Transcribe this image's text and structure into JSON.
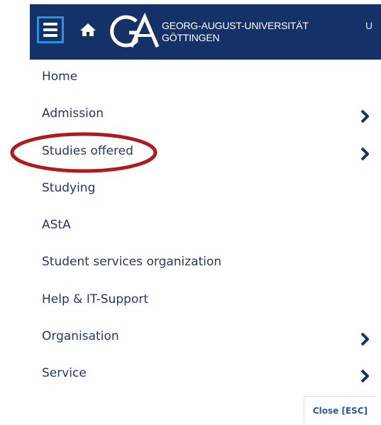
{
  "header": {
    "menu_icon": "hamburger-menu-icon",
    "home_icon": "home-icon",
    "logo_icon": "university-logo",
    "uni_name_line1": "GEORG-AUGUST-UNIVERSITÄT",
    "uni_name_line2": "GÖTTINGEN",
    "truncated_text": "U",
    "background_color": "#153268"
  },
  "nav": {
    "items": [
      {
        "label": "Home",
        "has_submenu": false
      },
      {
        "label": "Admission",
        "has_submenu": true
      },
      {
        "label": "Studies offered",
        "has_submenu": true,
        "annotated": true
      },
      {
        "label": "Studying",
        "has_submenu": false
      },
      {
        "label": "AStA",
        "has_submenu": false
      },
      {
        "label": "Student services organization",
        "has_submenu": false
      },
      {
        "label": "Help & IT-Support",
        "has_submenu": false
      },
      {
        "label": "Organisation",
        "has_submenu": true
      },
      {
        "label": "Service",
        "has_submenu": true
      }
    ],
    "text_color": "#1f3a66",
    "chevron_icon": "chevron-right-icon"
  },
  "annotation": {
    "color": "#b01a1e",
    "shape": "ellipse"
  },
  "close_button": {
    "label": "Close [ESC]",
    "color": "#2a5a98"
  }
}
